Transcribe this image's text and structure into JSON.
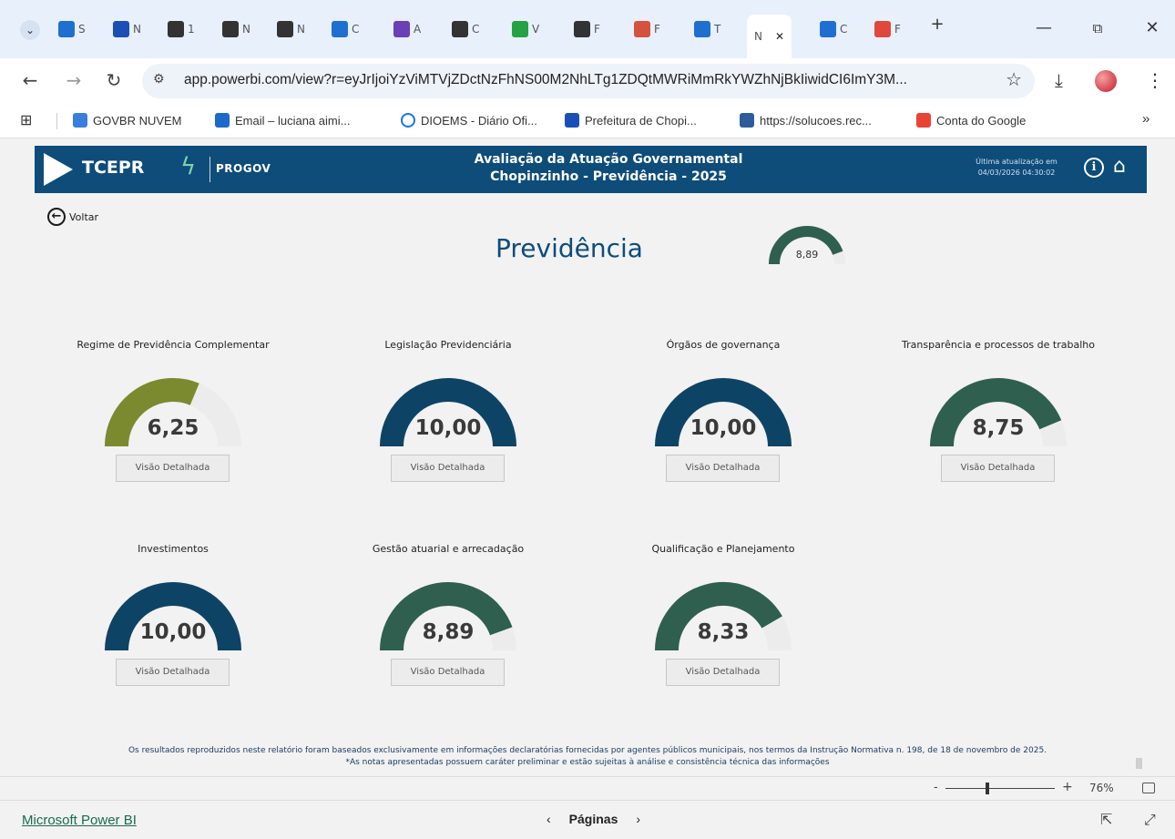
{
  "browser": {
    "tabs": [
      {
        "label": "S",
        "color": "#1f6fd1"
      },
      {
        "label": "N",
        "color": "#1a4fb6"
      },
      {
        "label": "1",
        "color": "#333333"
      },
      {
        "label": "N",
        "color": "#333333"
      },
      {
        "label": "N",
        "color": "#333333"
      },
      {
        "label": "C",
        "color": "#1f6fd1"
      },
      {
        "label": "A",
        "color": "#6a3fb8"
      },
      {
        "label": "C",
        "color": "#333333"
      },
      {
        "label": "V",
        "color": "#25a244"
      },
      {
        "label": "F",
        "color": "#333333"
      },
      {
        "label": "F",
        "color": "#d5533e"
      },
      {
        "label": "T",
        "color": "#1f6fd1"
      }
    ],
    "active_tab_label": "N",
    "tabs_after": [
      {
        "label": "C",
        "color": "#1f6fd1"
      },
      {
        "label": "F",
        "color": "#e0483b"
      }
    ],
    "new_tab": "+",
    "url": "app.powerbi.com/view?r=eyJrIjoiYzViMTVjZDctNzFhNS00M2NhLTg1ZDQtMWRiMmRkYWZhNjBkIiwidCI6ImY3M...",
    "bookmarks": [
      {
        "label": "GOVBR NUVEM",
        "icon": "folder-icon",
        "color": "#3b7ddd"
      },
      {
        "label": "Email – luciana aimi...",
        "icon": "outlook-icon",
        "color": "#1b6ac9"
      },
      {
        "label": "DIOEMS - Diário Ofi...",
        "icon": "circle-icon",
        "color": "#1a73e8"
      },
      {
        "label": "Prefeitura de Chopi...",
        "icon": "d-icon",
        "color": "#1a4fb6"
      },
      {
        "label": "https://solucoes.rec...",
        "icon": "globe-icon",
        "color": "#2e5c9a"
      },
      {
        "label": "Conta do Google",
        "icon": "google-icon",
        "color": "#ea4335"
      }
    ],
    "bookmarks_more": "»"
  },
  "header": {
    "brand": "TCEPR",
    "progov": "PROGOV",
    "title_line1": "Avaliação da Atuação Governamental",
    "title_line2": "Chopinzinho - Previdência - 2025",
    "update_label": "Última atualização em",
    "update_time": "04/03/2026 04:30:02"
  },
  "back_label": "Voltar",
  "page_title": "Previdência",
  "overall_score": {
    "label": "8,89",
    "value": 8.89,
    "max": 10,
    "color": "#2f5f4f"
  },
  "cards": [
    {
      "title": "Regime de Previdência Complementar",
      "value_label": "6,25",
      "value": 6.25,
      "color": "#7b8a2f",
      "button": "Visão Detalhada"
    },
    {
      "title": "Legislação Previdenciária",
      "value_label": "10,00",
      "value": 10.0,
      "color": "#0d4465",
      "button": "Visão Detalhada"
    },
    {
      "title": "Órgãos de governança",
      "value_label": "10,00",
      "value": 10.0,
      "color": "#0d4465",
      "button": "Visão Detalhada"
    },
    {
      "title": "Transparência e processos de trabalho",
      "value_label": "8,75",
      "value": 8.75,
      "color": "#2f5f4f",
      "button": "Visão Detalhada"
    },
    {
      "title": "Investimentos",
      "value_label": "10,00",
      "value": 10.0,
      "color": "#0d4465",
      "button": "Visão Detalhada"
    },
    {
      "title": "Gestão atuarial e arrecadação",
      "value_label": "8,89",
      "value": 8.89,
      "color": "#2f5f4f",
      "button": "Visão Detalhada"
    },
    {
      "title": "Qualificação e Planejamento",
      "value_label": "8,33",
      "value": 8.33,
      "color": "#2f5f4f",
      "button": "Visão Detalhada"
    }
  ],
  "gauge_track_color": "#ececec",
  "disclaimer_line1": "Os resultados reproduzidos neste relatório foram baseados exclusivamente em informações declaratórias fornecidas por agentes públicos municipais, nos termos da Instrução Normativa n. 198, de 18 de novembro de 2025.",
  "disclaimer_line2": "*As notas apresentadas possuem caráter preliminar e estão sujeitas à análise e consistência técnica das informações",
  "zoom": {
    "minus": "-",
    "plus": "+",
    "percent": "76%",
    "level": 0.76
  },
  "footer": {
    "brand_link": "Microsoft Power BI",
    "pages_label": "Páginas",
    "prev": "‹",
    "next": "›"
  }
}
